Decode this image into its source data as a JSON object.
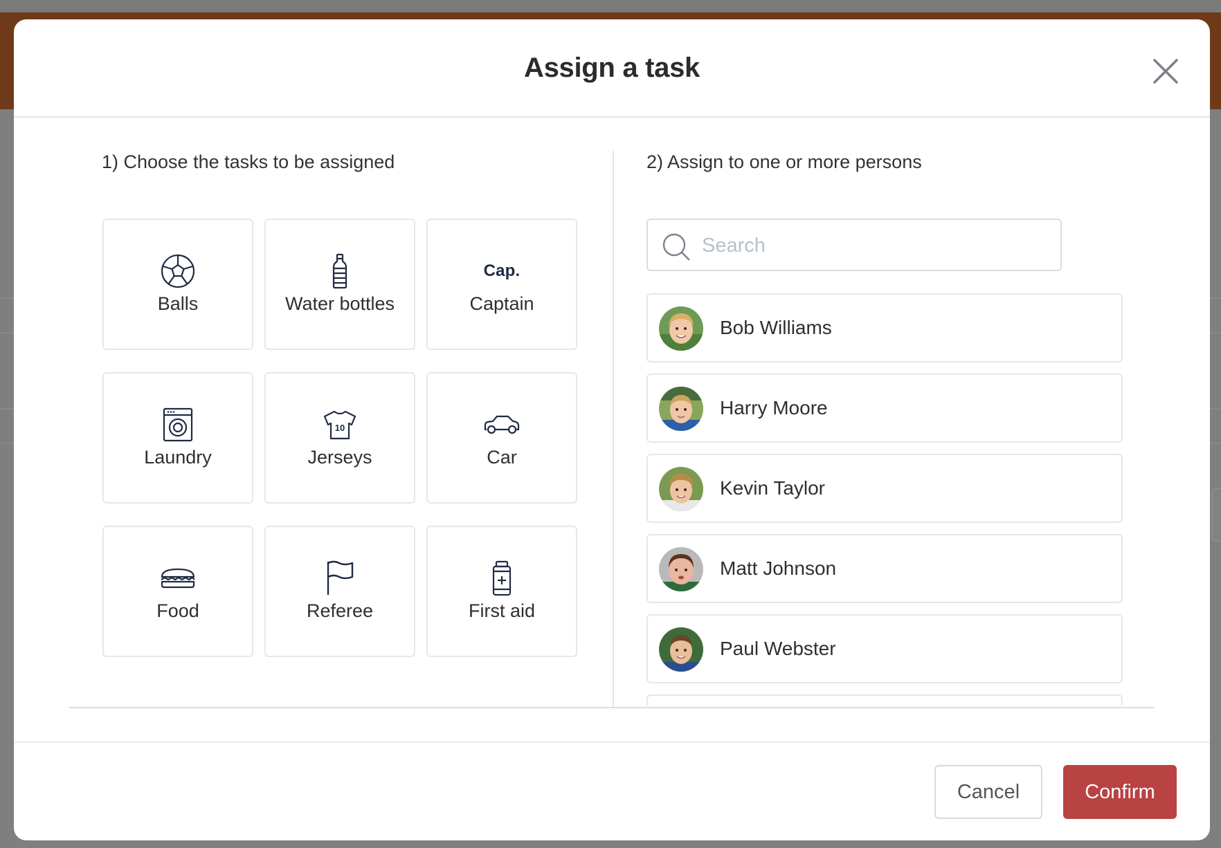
{
  "modal": {
    "title": "Assign a task",
    "close_icon": "close-icon"
  },
  "tasks_section": {
    "label": "1) Choose the tasks to be assigned",
    "tasks": [
      {
        "label": "Balls",
        "icon": "ball-icon"
      },
      {
        "label": "Water bottles",
        "icon": "water-bottle-icon"
      },
      {
        "label": "Captain",
        "icon": "captain-icon",
        "icon_text": "Cap."
      },
      {
        "label": "Laundry",
        "icon": "washing-machine-icon"
      },
      {
        "label": "Jerseys",
        "icon": "jersey-icon",
        "icon_text": "10"
      },
      {
        "label": "Car",
        "icon": "car-icon"
      },
      {
        "label": "Food",
        "icon": "sandwich-icon"
      },
      {
        "label": "Referee",
        "icon": "flag-icon"
      },
      {
        "label": "First aid",
        "icon": "first-aid-icon"
      }
    ]
  },
  "persons_section": {
    "label": "2) Assign to one or more persons",
    "search": {
      "placeholder": "Search",
      "value": ""
    },
    "persons": [
      {
        "name": "Bob Williams"
      },
      {
        "name": "Harry Moore"
      },
      {
        "name": "Kevin Taylor"
      },
      {
        "name": "Matt Johnson"
      },
      {
        "name": "Paul Webster"
      }
    ]
  },
  "footer": {
    "cancel_label": "Cancel",
    "confirm_label": "Confirm"
  },
  "colors": {
    "accent": "#b94343",
    "header_background": "#6e3a1a",
    "icon_stroke": "#1f2a44"
  }
}
